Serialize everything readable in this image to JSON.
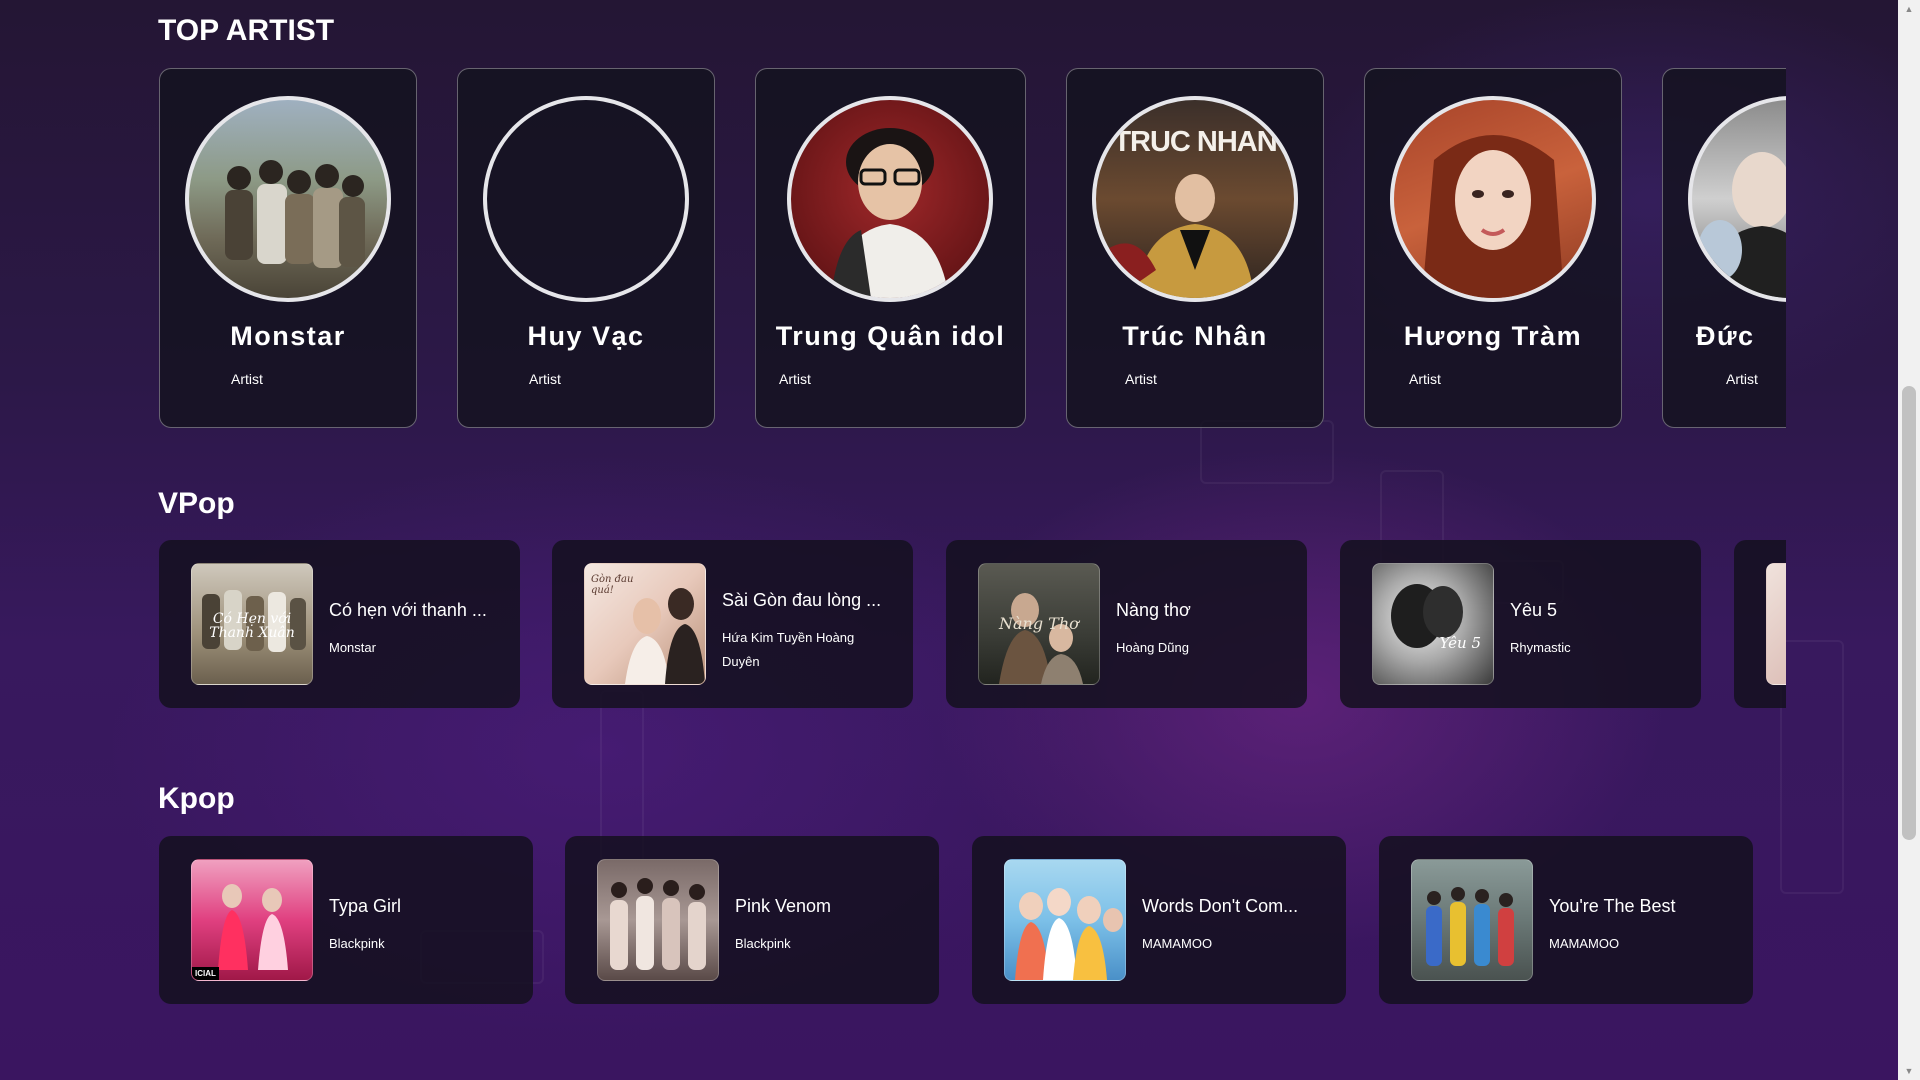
{
  "sections": {
    "top_artist_title": "TOP ARTIST",
    "vpop_title": "VPop",
    "kpop_title": "Kpop"
  },
  "artists": [
    {
      "name": "Monstar",
      "role": "Artist"
    },
    {
      "name": "Huy Vạc",
      "role": "Artist"
    },
    {
      "name": "Trung Quân idol",
      "role": "Artist"
    },
    {
      "name": "Trúc Nhân",
      "role": "Artist",
      "photo_caption": "TRUC NHAN"
    },
    {
      "name": "Hương Tràm",
      "role": "Artist"
    },
    {
      "name": "Đức",
      "role": "Artist"
    }
  ],
  "vpop": [
    {
      "title": "Có hẹn với thanh ...",
      "artist": "Monstar",
      "cover_text": "Có Hẹn với Thanh Xuân"
    },
    {
      "title": "Sài Gòn đau lòng ...",
      "artist": "Hứa Kim Tuyền Hoàng Duyên",
      "cover_text": "Gòn đau quá!"
    },
    {
      "title": "Nàng thơ",
      "artist": "Hoàng Dũng",
      "cover_text": "Nàng Thơ"
    },
    {
      "title": "Yêu 5",
      "artist": "Rhymastic",
      "cover_text": "Yêu 5"
    }
  ],
  "kpop": [
    {
      "title": "Typa Girl",
      "artist": "Blackpink",
      "cover_text": "ICIAL"
    },
    {
      "title": "Pink Venom",
      "artist": "Blackpink"
    },
    {
      "title": "Words Don't Com...",
      "artist": "MAMAMOO"
    },
    {
      "title": "You're The Best",
      "artist": "MAMAMOO"
    }
  ],
  "colors": {
    "accent_bg": "#2c1848",
    "card_bg": "#14121e",
    "avatar_border": "#e6e6ea"
  },
  "icons": {
    "scroll_up": "scroll-up-arrow-icon",
    "scroll_down": "scroll-down-arrow-icon"
  }
}
